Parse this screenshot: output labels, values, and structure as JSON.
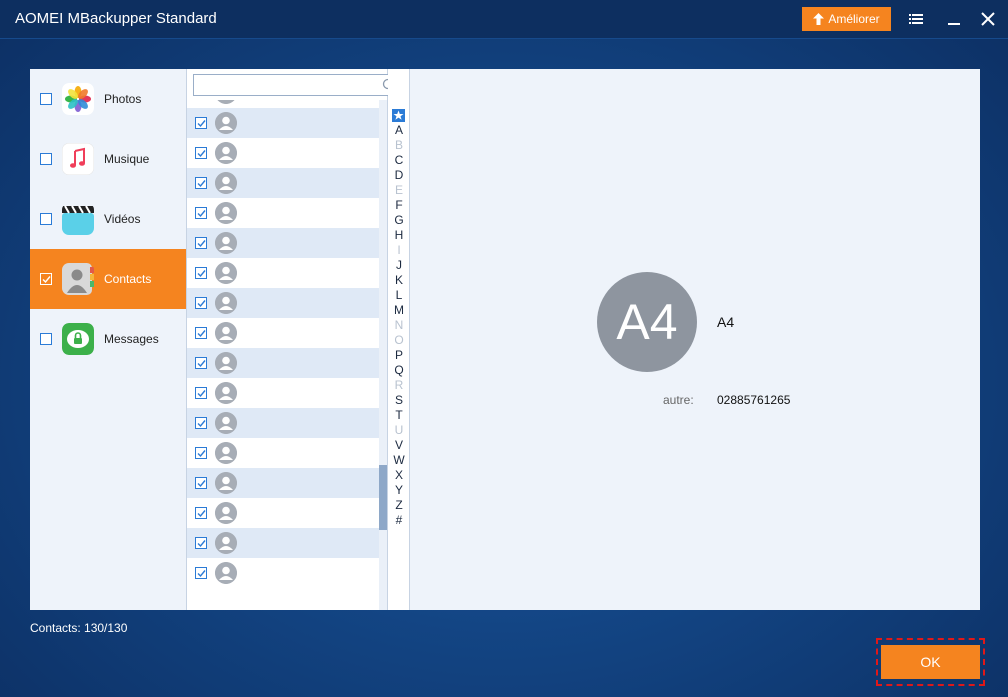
{
  "window": {
    "title": "AOMEI MBackupper Standard",
    "upgrade_label": "Améliorer"
  },
  "categories": [
    {
      "label": "Photos",
      "checked": false,
      "icon": "photos-icon"
    },
    {
      "label": "Musique",
      "checked": false,
      "icon": "music-icon"
    },
    {
      "label": "Vidéos",
      "checked": false,
      "icon": "videos-icon"
    },
    {
      "label": "Contacts",
      "checked": true,
      "icon": "contacts-icon"
    },
    {
      "label": "Messages",
      "checked": false,
      "icon": "messages-icon"
    }
  ],
  "search": {
    "placeholder": "",
    "value": ""
  },
  "contacts": {
    "row_count": 17,
    "rows_checked": true
  },
  "alphabet": {
    "star": "★",
    "letters": [
      "A",
      "B",
      "C",
      "D",
      "E",
      "F",
      "G",
      "H",
      "I",
      "J",
      "K",
      "L",
      "M",
      "N",
      "O",
      "P",
      "Q",
      "R",
      "S",
      "T",
      "U",
      "V",
      "W",
      "X",
      "Y",
      "Z",
      "#"
    ],
    "dimmed": [
      "B",
      "E",
      "I",
      "N",
      "O",
      "R",
      "U"
    ]
  },
  "detail": {
    "avatar_text": "A4",
    "name": "A4",
    "field_label": "autre:",
    "phone": "02885761265"
  },
  "footer": {
    "count_text": "Contacts: 130/130",
    "ok_label": "OK"
  },
  "colors": {
    "accent": "#f5841f",
    "checkbox": "#2b7bd6",
    "highlight": "#e01818"
  }
}
